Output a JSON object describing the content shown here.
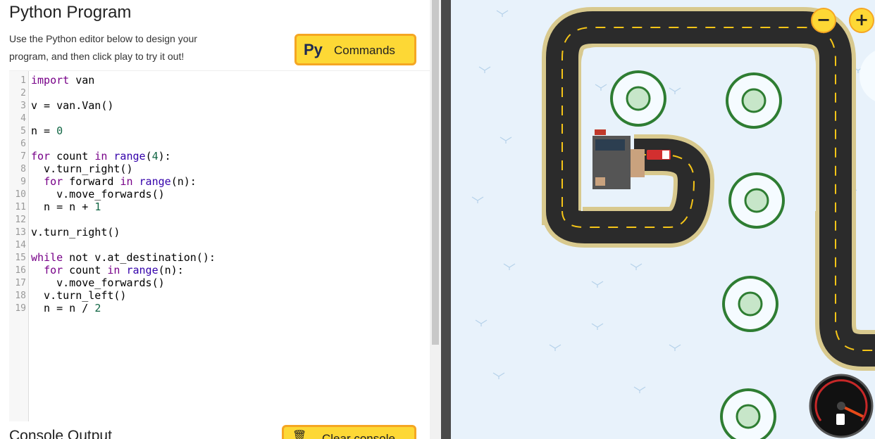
{
  "header": {
    "title": "Python Program",
    "description": "Use the Python editor below to design your program, and then click play to try it out!"
  },
  "commands_button": {
    "icon": "Py",
    "label": "Commands"
  },
  "editor": {
    "lines": [
      {
        "n": "1"
      },
      {
        "n": "2"
      },
      {
        "n": "3"
      },
      {
        "n": "4"
      },
      {
        "n": "5"
      },
      {
        "n": "6"
      },
      {
        "n": "7"
      },
      {
        "n": "8"
      },
      {
        "n": "9"
      },
      {
        "n": "10"
      },
      {
        "n": "11"
      },
      {
        "n": "12"
      },
      {
        "n": "13"
      },
      {
        "n": "14"
      },
      {
        "n": "15"
      },
      {
        "n": "16"
      },
      {
        "n": "17"
      },
      {
        "n": "18"
      },
      {
        "n": "19"
      }
    ]
  },
  "console": {
    "title": "Console Output",
    "clear_label": "Clear console"
  },
  "zoom": {
    "out": "−",
    "in": "+"
  },
  "colors": {
    "accent": "#fdd835",
    "accent_border": "#f5a623",
    "road": "#2b2b2b",
    "road_edge": "#d8c98e",
    "snow_bg": "#e8f2fb"
  },
  "icons": [
    "python-icon",
    "trash-icon",
    "zoom-out-icon",
    "zoom-in-icon",
    "fuel-gauge-icon",
    "van-icon",
    "house-icon",
    "tree-icon"
  ]
}
